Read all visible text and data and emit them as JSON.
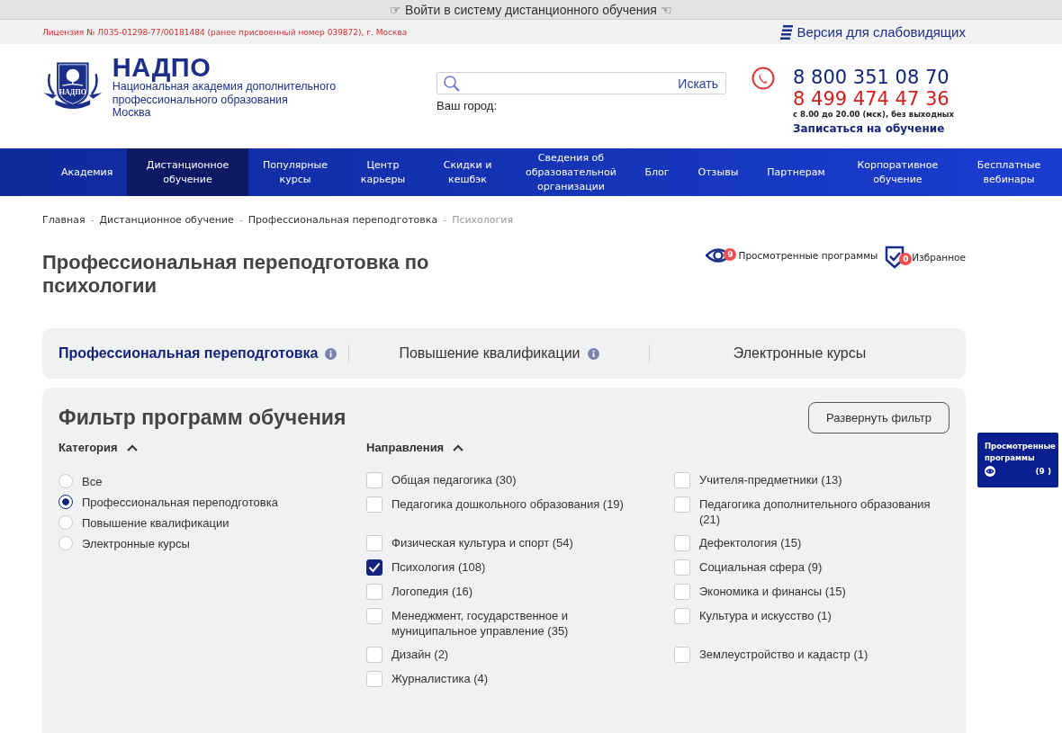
{
  "top_bar": {
    "login_link": "☞ Войти в систему дистанционного обучения ☜"
  },
  "info_bar": {
    "license": "Лицензия № Л035-01298-77/00181484 (ранее присвоенный номер 039872), г. Москва",
    "accessibility_link": "Версия для слабовидящих"
  },
  "header": {
    "logo_title": "НАДПО",
    "logo_emblem_text": "НАДПО",
    "org_name": "Национальная академия дополнительного профессионального образования",
    "city": "Москва",
    "search": {
      "button": "Искать"
    },
    "city_label": "Ваш город:",
    "phones": [
      "8 800 351 08 70",
      "8 499 474 47 36"
    ],
    "hours": "с 8.00 до 20.00 (мск), без выходных",
    "signup_link": "Записаться на обучение"
  },
  "nav": [
    {
      "label": "Академия",
      "selected": false
    },
    {
      "label": "Дистанционное обучение",
      "selected": true
    },
    {
      "label": "Популярные курсы",
      "selected": false
    },
    {
      "label": "Центр карьеры",
      "selected": false
    },
    {
      "label": "Скидки и кешбэк",
      "selected": false
    },
    {
      "label": "Сведения об образовательной организации",
      "selected": false
    },
    {
      "label": "Блог",
      "selected": false
    },
    {
      "label": "Отзывы",
      "selected": false
    },
    {
      "label": "Партнерам",
      "selected": false
    },
    {
      "label": "Корпоративное обучение",
      "selected": false
    },
    {
      "label": "Бесплатные вебинары",
      "selected": false
    }
  ],
  "breadcrumb_separator": "-",
  "breadcrumbs": [
    {
      "label": "Главная",
      "current": false
    },
    {
      "label": "Дистанционное обучение",
      "current": false
    },
    {
      "label": "Профессиональная переподготовка",
      "current": false
    },
    {
      "label": "Психология",
      "current": true
    }
  ],
  "page_title": "Профессиональная переподготовка по психологии",
  "viewed": {
    "label": "Просмотренные программы",
    "count": "9"
  },
  "favorites": {
    "label": "Избранное",
    "count": "0"
  },
  "program_tabs": [
    {
      "label": "Профессиональная переподготовка",
      "selected": true,
      "info": true
    },
    {
      "label": "Повышение квалификации",
      "selected": false,
      "info": true
    },
    {
      "label": "Электронные курсы",
      "selected": false,
      "info": false
    }
  ],
  "filter": {
    "title": "Фильтр программ обучения",
    "expand_button": "Развернуть фильтр",
    "category": {
      "label": "Категория",
      "expanded": true,
      "options": [
        {
          "label": "Все",
          "selected": false
        },
        {
          "label": "Профессиональная переподготовка",
          "selected": true
        },
        {
          "label": "Повышение квалификации",
          "selected": false
        },
        {
          "label": "Электронные курсы",
          "selected": false
        }
      ]
    },
    "directions": {
      "label": "Направления",
      "expanded": true,
      "options": [
        {
          "label": "Общая педагогика (30)",
          "checked": false
        },
        {
          "label": "Учителя-предметники (13)",
          "checked": false
        },
        {
          "label": "Педагогика дошкольного образования (19)",
          "checked": false
        },
        {
          "label": "Педагогика дополнительного образования (21)",
          "checked": false
        },
        {
          "label": "Физическая культура и спорт (54)",
          "checked": false
        },
        {
          "label": "Дефектология (15)",
          "checked": false
        },
        {
          "label": "Психология (108)",
          "checked": true
        },
        {
          "label": "Социальная сфера (9)",
          "checked": false
        },
        {
          "label": "Логопедия (16)",
          "checked": false
        },
        {
          "label": "Экономика и финансы (15)",
          "checked": false
        },
        {
          "label": "Менеджмент, государственное и муниципальное управление (35)",
          "checked": false
        },
        {
          "label": "Культура и искусство (1)",
          "checked": false
        },
        {
          "label": "Дизайн (2)",
          "checked": false
        },
        {
          "label": "Землеустройство и кадастр (1)",
          "checked": false
        },
        {
          "label": "Журналистика (4)",
          "checked": false
        }
      ]
    }
  },
  "viewed_widget": {
    "label": "Просмотренные программы",
    "count": "(9 )"
  }
}
